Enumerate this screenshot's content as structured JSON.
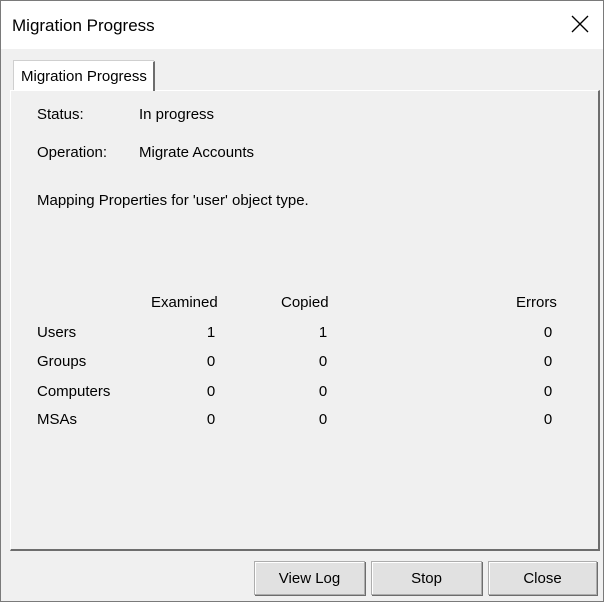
{
  "window": {
    "title": "Migration Progress"
  },
  "tab": {
    "label": "Migration Progress"
  },
  "status": {
    "label": "Status:",
    "value": "In progress"
  },
  "operation": {
    "label": "Operation:",
    "value": "Migrate Accounts"
  },
  "message": "Mapping Properties for 'user' object type.",
  "table": {
    "columns": [
      "Examined",
      "Copied",
      "Errors"
    ],
    "rows": [
      {
        "name": "Users",
        "examined": "1",
        "copied": "1",
        "errors": "0"
      },
      {
        "name": "Groups",
        "examined": "0",
        "copied": "0",
        "errors": "0"
      },
      {
        "name": "Computers",
        "examined": "0",
        "copied": "0",
        "errors": "0"
      },
      {
        "name": "MSAs",
        "examined": "0",
        "copied": "0",
        "errors": "0"
      }
    ]
  },
  "buttons": {
    "view_log": "View Log",
    "stop": "Stop",
    "close": "Close"
  },
  "icons": {
    "close": "close-icon"
  }
}
